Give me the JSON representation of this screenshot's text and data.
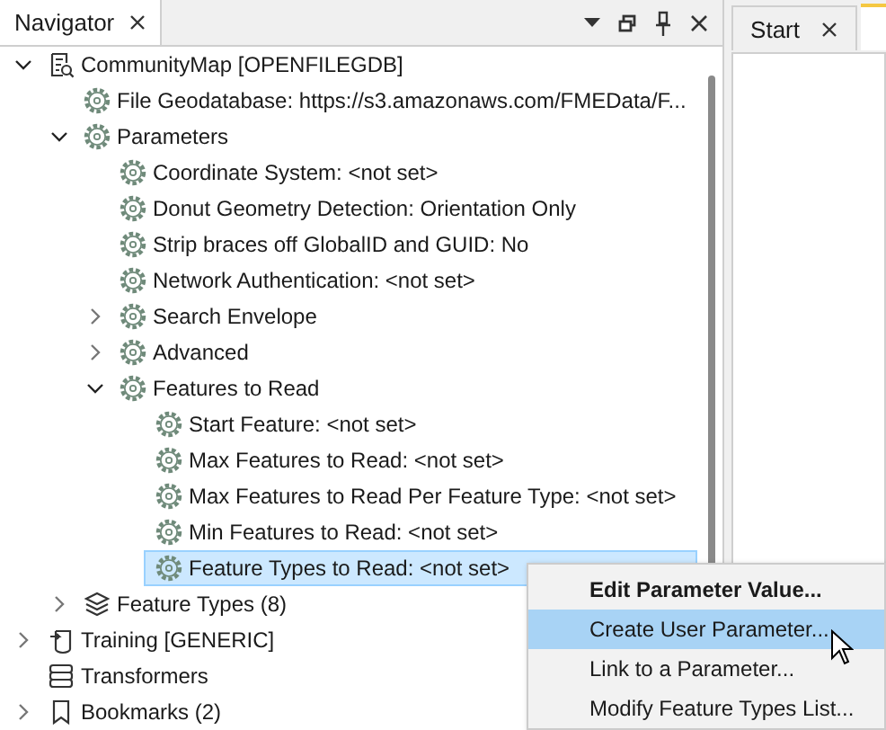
{
  "navigator": {
    "title": "Navigator",
    "tree": [
      {
        "label": "CommunityMap [OPENFILEGDB]",
        "kind": "reader",
        "expanded": true,
        "selected": false,
        "children": [
          {
            "label": "File Geodatabase: https://s3.amazonaws.com/FMEData/F...",
            "kind": "gear",
            "selected": false
          },
          {
            "label": "Parameters",
            "kind": "gear",
            "expanded": true,
            "selected": false,
            "children": [
              {
                "label": "Coordinate System: <not set>",
                "kind": "gear",
                "selected": false
              },
              {
                "label": "Donut Geometry Detection: Orientation Only",
                "kind": "gear",
                "selected": false
              },
              {
                "label": "Strip braces off GlobalID and GUID: No",
                "kind": "gear",
                "selected": false
              },
              {
                "label": "Network Authentication: <not set>",
                "kind": "gear",
                "selected": false
              },
              {
                "label": "Search Envelope",
                "kind": "gear",
                "expanded": false,
                "selected": false
              },
              {
                "label": "Advanced",
                "kind": "gear",
                "expanded": false,
                "selected": false
              },
              {
                "label": "Features to Read",
                "kind": "gear",
                "expanded": true,
                "selected": false,
                "children": [
                  {
                    "label": "Start Feature: <not set>",
                    "kind": "gear",
                    "selected": false
                  },
                  {
                    "label": "Max Features to Read: <not set>",
                    "kind": "gear",
                    "selected": false
                  },
                  {
                    "label": "Max Features to Read Per Feature Type: <not set>",
                    "kind": "gear",
                    "selected": false
                  },
                  {
                    "label": "Min Features to Read: <not set>",
                    "kind": "gear",
                    "selected": false
                  },
                  {
                    "label": "Feature Types to Read: <not set>",
                    "kind": "gear",
                    "selected": true
                  }
                ]
              }
            ]
          },
          {
            "label": "Feature Types (8)",
            "kind": "layers",
            "expanded": false,
            "selected": false
          }
        ]
      },
      {
        "label": "Training [GENERIC]",
        "kind": "writer",
        "expanded": false,
        "selected": false
      },
      {
        "label": "Transformers",
        "kind": "transformers",
        "selected": false
      },
      {
        "label": "Bookmarks (2)",
        "kind": "bookmark",
        "expanded": false,
        "selected": false
      }
    ]
  },
  "editor_tabs": [
    {
      "label": "Start",
      "selected": false
    }
  ],
  "context_menu": [
    {
      "label": "Edit Parameter Value...",
      "kind": "default",
      "selected": false
    },
    {
      "label": "Create User Parameter...",
      "kind": "normal",
      "selected": true
    },
    {
      "label": "Link to a Parameter...",
      "kind": "normal",
      "selected": false
    },
    {
      "label": "Modify Feature Types List...",
      "kind": "normal",
      "selected": false
    }
  ]
}
